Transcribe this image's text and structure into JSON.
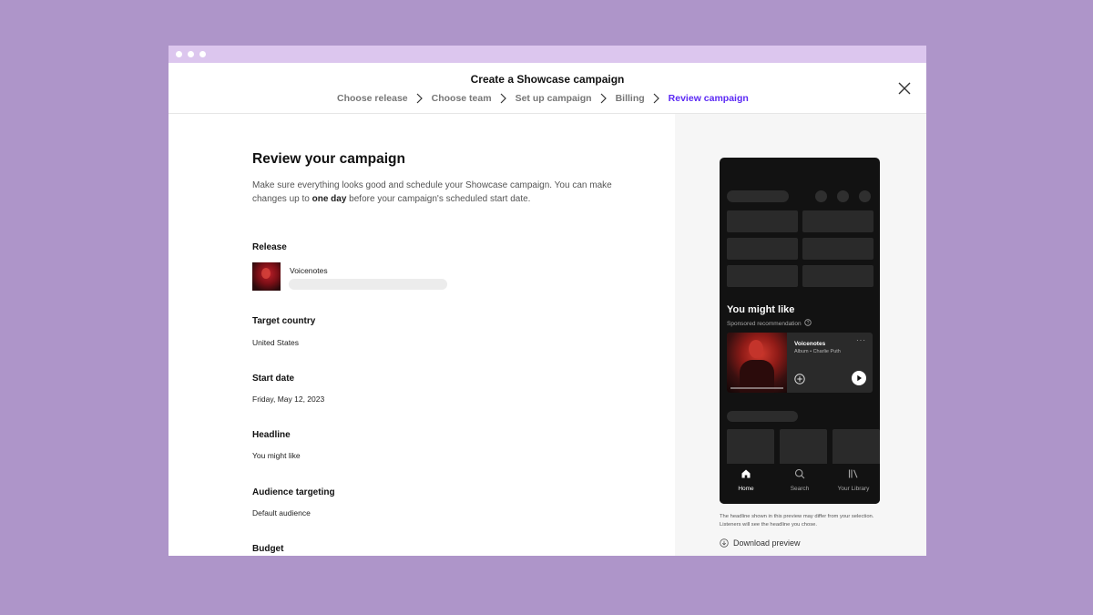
{
  "modal": {
    "title": "Create a Showcase campaign",
    "steps": [
      {
        "label": "Choose release",
        "active": false
      },
      {
        "label": "Choose team",
        "active": false
      },
      {
        "label": "Set up campaign",
        "active": false
      },
      {
        "label": "Billing",
        "active": false
      },
      {
        "label": "Review campaign",
        "active": true
      }
    ],
    "accent_color": "#5b29f4"
  },
  "review": {
    "heading": "Review your campaign",
    "intro_part1": "Make sure everything looks good and schedule your Showcase campaign. You can make changes up to ",
    "intro_bold": "one day",
    "intro_part2": " before your campaign's scheduled start date.",
    "release_label": "Release",
    "release_name": "Voicenotes",
    "target_country_label": "Target country",
    "target_country_value": "United States",
    "start_date_label": "Start date",
    "start_date_value": "Friday, May 12, 2023",
    "headline_label": "Headline",
    "headline_value": "You might like",
    "audience_label": "Audience targeting",
    "audience_value": "Default audience",
    "budget_label": "Budget"
  },
  "preview": {
    "section_title": "You might like",
    "sponsored": "Sponsored recommendation",
    "card_title": "Voicenotes",
    "card_subtitle": "Album • Charlie Puth",
    "more": "···",
    "nav": [
      {
        "label": "Home",
        "icon": "home-icon",
        "active": true
      },
      {
        "label": "Search",
        "icon": "search-icon",
        "active": false
      },
      {
        "label": "Your Library",
        "icon": "library-icon",
        "active": false
      }
    ],
    "disclaimer": "The headline shown in this preview may differ from your selection. Listeners will see the headline you chose.",
    "download_label": "Download preview"
  }
}
